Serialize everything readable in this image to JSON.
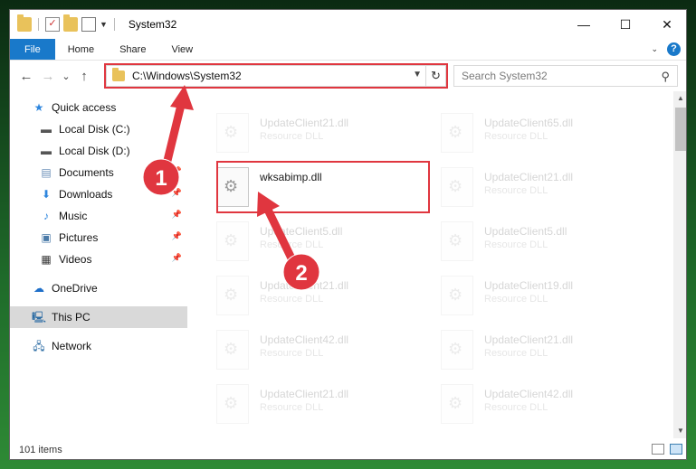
{
  "window": {
    "title": "System32",
    "controls": {
      "minimize": "—",
      "maximize": "☐",
      "close": "✕"
    }
  },
  "ribbon": {
    "tabs": [
      "File",
      "Home",
      "Share",
      "View"
    ],
    "help": "?"
  },
  "nav": {
    "back": "←",
    "forward": "→",
    "recent": "⌄",
    "up": "↑",
    "address": "C:\\Windows\\System32",
    "search_placeholder": "Search System32"
  },
  "sidebar": {
    "items": [
      {
        "label": "Quick access",
        "icon": "star-icon"
      },
      {
        "label": "Local Disk (C:)",
        "icon": "drive-icon"
      },
      {
        "label": "Local Disk (D:)",
        "icon": "drive-icon"
      },
      {
        "label": "Documents",
        "icon": "documents-icon"
      },
      {
        "label": "Downloads",
        "icon": "downloads-icon"
      },
      {
        "label": "Music",
        "icon": "music-icon"
      },
      {
        "label": "Pictures",
        "icon": "pictures-icon"
      },
      {
        "label": "Videos",
        "icon": "videos-icon"
      },
      {
        "label": "OneDrive",
        "icon": "cloud-icon"
      },
      {
        "label": "This PC",
        "icon": "computer-icon"
      },
      {
        "label": "Network",
        "icon": "network-icon"
      }
    ]
  },
  "files": {
    "left": [
      {
        "name": "UpdateClient21.dll",
        "type": "Resource DLL"
      },
      {
        "name": "wksabimp.dll",
        "type": ""
      },
      {
        "name": "UpdateClient5.dll",
        "type": "Resource DLL"
      },
      {
        "name": "UpdateClient21.dll",
        "type": "Resource DLL"
      },
      {
        "name": "UpdateClient42.dll",
        "type": "Resource DLL"
      },
      {
        "name": "UpdateClient21.dll",
        "type": "Resource DLL"
      }
    ],
    "right": [
      {
        "name": "UpdateClient65.dll",
        "type": "Resource DLL"
      },
      {
        "name": "UpdateClient21.dll",
        "type": "Resource DLL"
      },
      {
        "name": "UpdateClient5.dll",
        "type": "Resource DLL"
      },
      {
        "name": "UpdateClient19.dll",
        "type": "Resource DLL"
      },
      {
        "name": "UpdateClient21.dll",
        "type": "Resource DLL"
      },
      {
        "name": "UpdateClient42.dll",
        "type": "Resource DLL"
      }
    ]
  },
  "status": {
    "count": "101 items"
  },
  "annotations": {
    "step1": "1",
    "step2": "2",
    "color": "#e0363f"
  }
}
